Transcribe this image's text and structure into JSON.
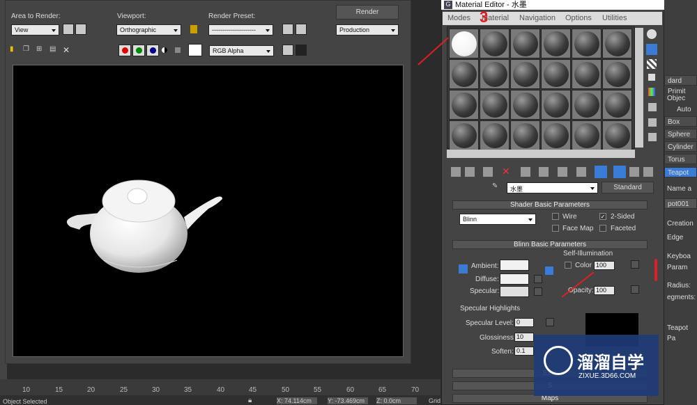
{
  "render": {
    "area_label": "Area to Render:",
    "area_value": "View",
    "viewport_label": "Viewport:",
    "viewport_value": "Orthographic",
    "preset_label": "Render Preset:",
    "preset_value": "---------------------",
    "render_btn": "Render",
    "production_value": "Production",
    "channel_value": "RGB Alpha"
  },
  "timeline": {
    "ticks": [
      "10",
      "15",
      "20",
      "25",
      "30",
      "35",
      "40",
      "45",
      "50",
      "55",
      "60",
      "65",
      "70"
    ]
  },
  "status": {
    "left": "Object Selected",
    "x": "X: 74.114cm",
    "y": "Y: -73.469cm",
    "z": "Z: 0.0cm",
    "grid": "Grid"
  },
  "me": {
    "title": "Material Editor - 水墨",
    "menu": [
      "Modes",
      "Material",
      "Navigation",
      "Options",
      "Utilities"
    ],
    "mat_name": "水墨",
    "mat_type": "Standard",
    "shader_section": "Shader Basic Parameters",
    "shader_value": "Blinn",
    "wire": "Wire",
    "two_sided": "2-Sided",
    "face_map": "Face Map",
    "faceted": "Faceted",
    "blinn_section": "Blinn Basic Parameters",
    "self_illum": "Self-Illumination",
    "ambient": "Ambient:",
    "diffuse": "Diffuse:",
    "specular": "Specular:",
    "color": "Color",
    "color_val": "100",
    "opacity": "Opacity:",
    "opacity_val": "100",
    "spec_hl": "Specular Highlights",
    "spec_level": "Specular Level:",
    "spec_level_val": "0",
    "gloss": "Glossiness:",
    "gloss_val": "10",
    "soften": "Soften:",
    "soften_val": "0.1",
    "ext": "Exte",
    "s": "S",
    "maps": "Maps"
  },
  "right": {
    "items": [
      "dard Primit",
      "Objec",
      "Auto",
      "Box",
      "Sphere",
      "Cylinder",
      "Torus",
      "Teapot",
      "Name a",
      "pot001",
      "Creation",
      "Edge",
      "Keyboa",
      "Param",
      "Radius:",
      "egments:",
      "Teapot Pa"
    ]
  },
  "anno": {
    "num3": "3"
  },
  "watermark": {
    "brand": "溜溜自学",
    "url": "ZIXUE.3D66.COM"
  },
  "colors": {
    "accent": "#3a7bd5",
    "annotation": "#e02020"
  }
}
